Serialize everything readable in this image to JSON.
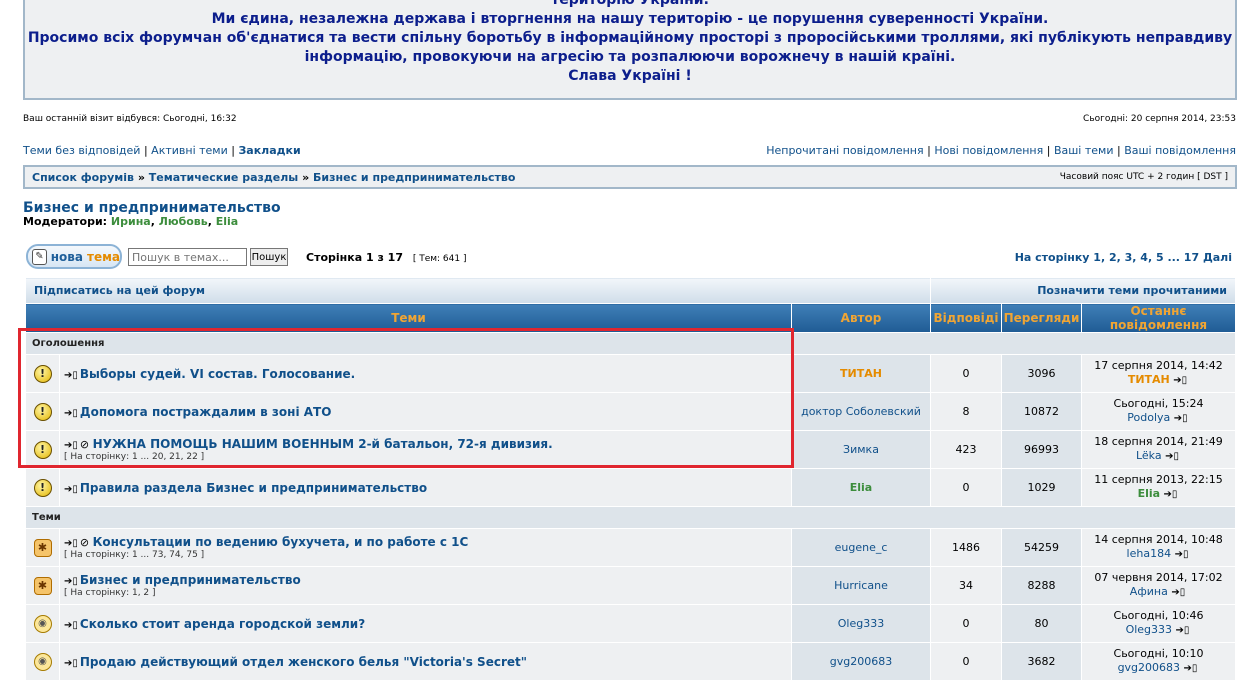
{
  "banner": {
    "line0": "територію України.",
    "line1": "Ми єдина, незалежна держава і вторгнення на нашу територію - це порушення суверенності України.",
    "line2": "Просимо всіх форумчан об'єднатися та вести спільну боротьбу в інформаційному просторі з проросійськими троллями, які публікують неправдиву",
    "line3": "інформацію, провокуючи на агресію та розпалюючи ворожнечу в нашій країні.",
    "line4": "Слава Україні !"
  },
  "visit": {
    "last": "Ваш останній візит відбувся: Сьогодні, 16:32",
    "now": "Сьогодні: 20 серпня 2014, 23:53"
  },
  "links_left": {
    "no_replies": "Теми без відповідей",
    "active": "Активні теми",
    "bookmarks": "Закладки"
  },
  "links_right": {
    "unread": "Непрочитані повідомлення",
    "new": "Нові повідомлення",
    "your_topics": "Ваші теми",
    "your_posts": "Ваші повідомлення"
  },
  "breadcrumb": {
    "b1": "Список форумів",
    "b2": "Тематические разделы",
    "b3": "Бизнес и предпринимательство",
    "tz": "Часовий пояс UTC + 2 годин [ DST ]"
  },
  "forum": {
    "title": "Бизнес и предпринимательство",
    "mods_label": "Модератори:",
    "mod1": "Ирина",
    "mod2": "Любовь",
    "mod3": "Elia"
  },
  "toolbar": {
    "new_label": "нова",
    "new_tema": "тема",
    "search_placeholder": "Пошук в темах...",
    "search_btn": "Пошук",
    "page_info": "Сторінка 1 з 17",
    "topics_count": "[ Тем: 641 ]",
    "pagination": "На сторінку 1, 2, 3, 4, 5 ... 17  Далі"
  },
  "table": {
    "subscribe": "Підписатись на цей форум",
    "mark_read": "Позначити теми прочитаними",
    "col_topics": "Теми",
    "col_author": "Автор",
    "col_replies": "Відповіді",
    "col_views": "Перегляди",
    "col_last": "Останнє повідомлення",
    "cat_ann": "Оголошення",
    "cat_topics": "Теми"
  },
  "rows": [
    {
      "title": "Выборы судей. VI состав. Голосование.",
      "pages": "",
      "author": "ТИТАН",
      "replies": "0",
      "views": "3096",
      "last_date": "17 серпня 2014, 14:42",
      "last_user": "ТИТАН"
    },
    {
      "title": "Допомога постраждалим в зоні АТО",
      "pages": "",
      "author": "доктор Соболевский",
      "replies": "8",
      "views": "10872",
      "last_date": "Сьогодні, 15:24",
      "last_user": "Podolya"
    },
    {
      "title": "НУЖНА ПОМОЩЬ НАШИМ ВОЕННЫМ 2-й батальон, 72-я дивизия.",
      "pages": "[ На сторінку: 1 ... 20, 21, 22 ]",
      "author": "Зимка",
      "replies": "423",
      "views": "96993",
      "last_date": "18 серпня 2014, 21:49",
      "last_user": "Lëka"
    },
    {
      "title": "Правила раздела Бизнес и предпринимательство",
      "pages": "",
      "author": "Elia",
      "replies": "0",
      "views": "1029",
      "last_date": "11 серпня 2013, 22:15",
      "last_user": "Elia"
    },
    {
      "title": "Консультации по ведению бухучета, и по работе с 1С",
      "pages": "[ На сторінку: 1 ... 73, 74, 75 ]",
      "author": "eugene_c",
      "replies": "1486",
      "views": "54259",
      "last_date": "14 серпня 2014, 10:48",
      "last_user": "leha184"
    },
    {
      "title": "Бизнес и предпринимательство",
      "pages": "[ На сторінку: 1, 2 ]",
      "author": "Hurricane",
      "replies": "34",
      "views": "8288",
      "last_date": "07 червня 2014, 17:02",
      "last_user": "Афина"
    },
    {
      "title": "Сколько стоит аренда городской земли?",
      "pages": "",
      "author": "Oleg333",
      "replies": "0",
      "views": "80",
      "last_date": "Сьогодні, 10:46",
      "last_user": "Oleg333"
    },
    {
      "title": "Продаю действующий отдел женского белья \"Victoria's Secret\"",
      "pages": "",
      "author": "gvg200683",
      "replies": "0",
      "views": "3682",
      "last_date": "Сьогодні, 10:10",
      "last_user": "gvg200683"
    }
  ]
}
